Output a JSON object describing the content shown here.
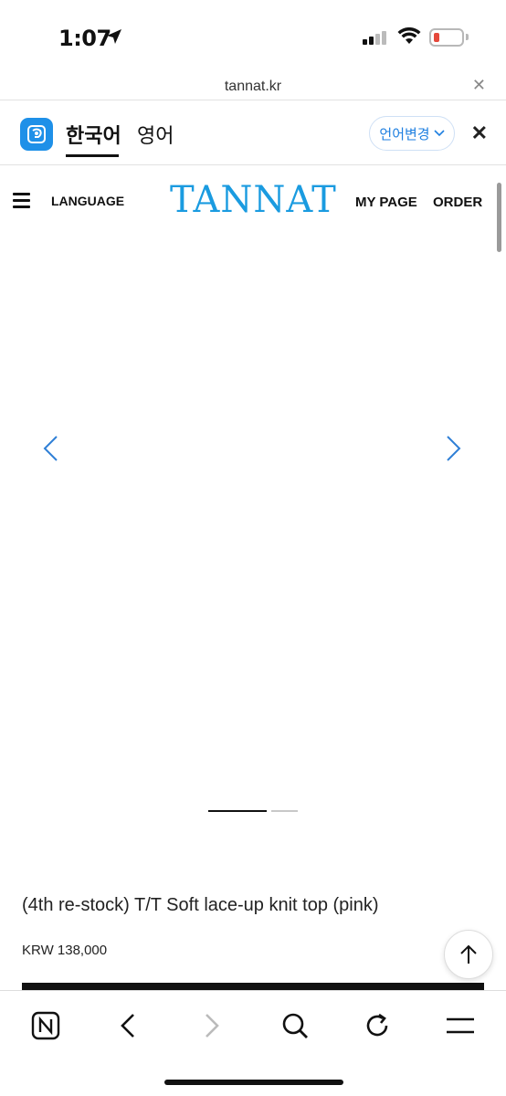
{
  "status_bar": {
    "time": "1:07",
    "battery_level": 0.2,
    "colors": {
      "battery_low": "#e5483b"
    }
  },
  "browser": {
    "url": "tannat.kr"
  },
  "translate_bar": {
    "source_lang": "한국어",
    "target_lang": "영어",
    "change_label": "언어변경",
    "icons": [
      "papago-icon",
      "chevron-down-icon",
      "close-icon"
    ]
  },
  "site_header": {
    "language_label": "LANGUAGE",
    "logo_text": "TANNAT",
    "mypage_label": "MY PAGE",
    "order_label": "ORDER",
    "colors": {
      "logo": "#1a9be0"
    }
  },
  "gallery": {
    "image_description_icon": "pink-knit-top-photo",
    "slide_count": 2,
    "active_slide": 1,
    "colors": {
      "arrows": "#2f7fd6"
    }
  },
  "product": {
    "title": "(4th re-stock) T/T Soft lace-up knit top (pink)",
    "price": "KRW 138,000"
  },
  "toolbar": {
    "icons": [
      "naver-home-icon",
      "back-icon",
      "forward-icon",
      "search-icon",
      "reload-icon",
      "menu-icon"
    ]
  }
}
